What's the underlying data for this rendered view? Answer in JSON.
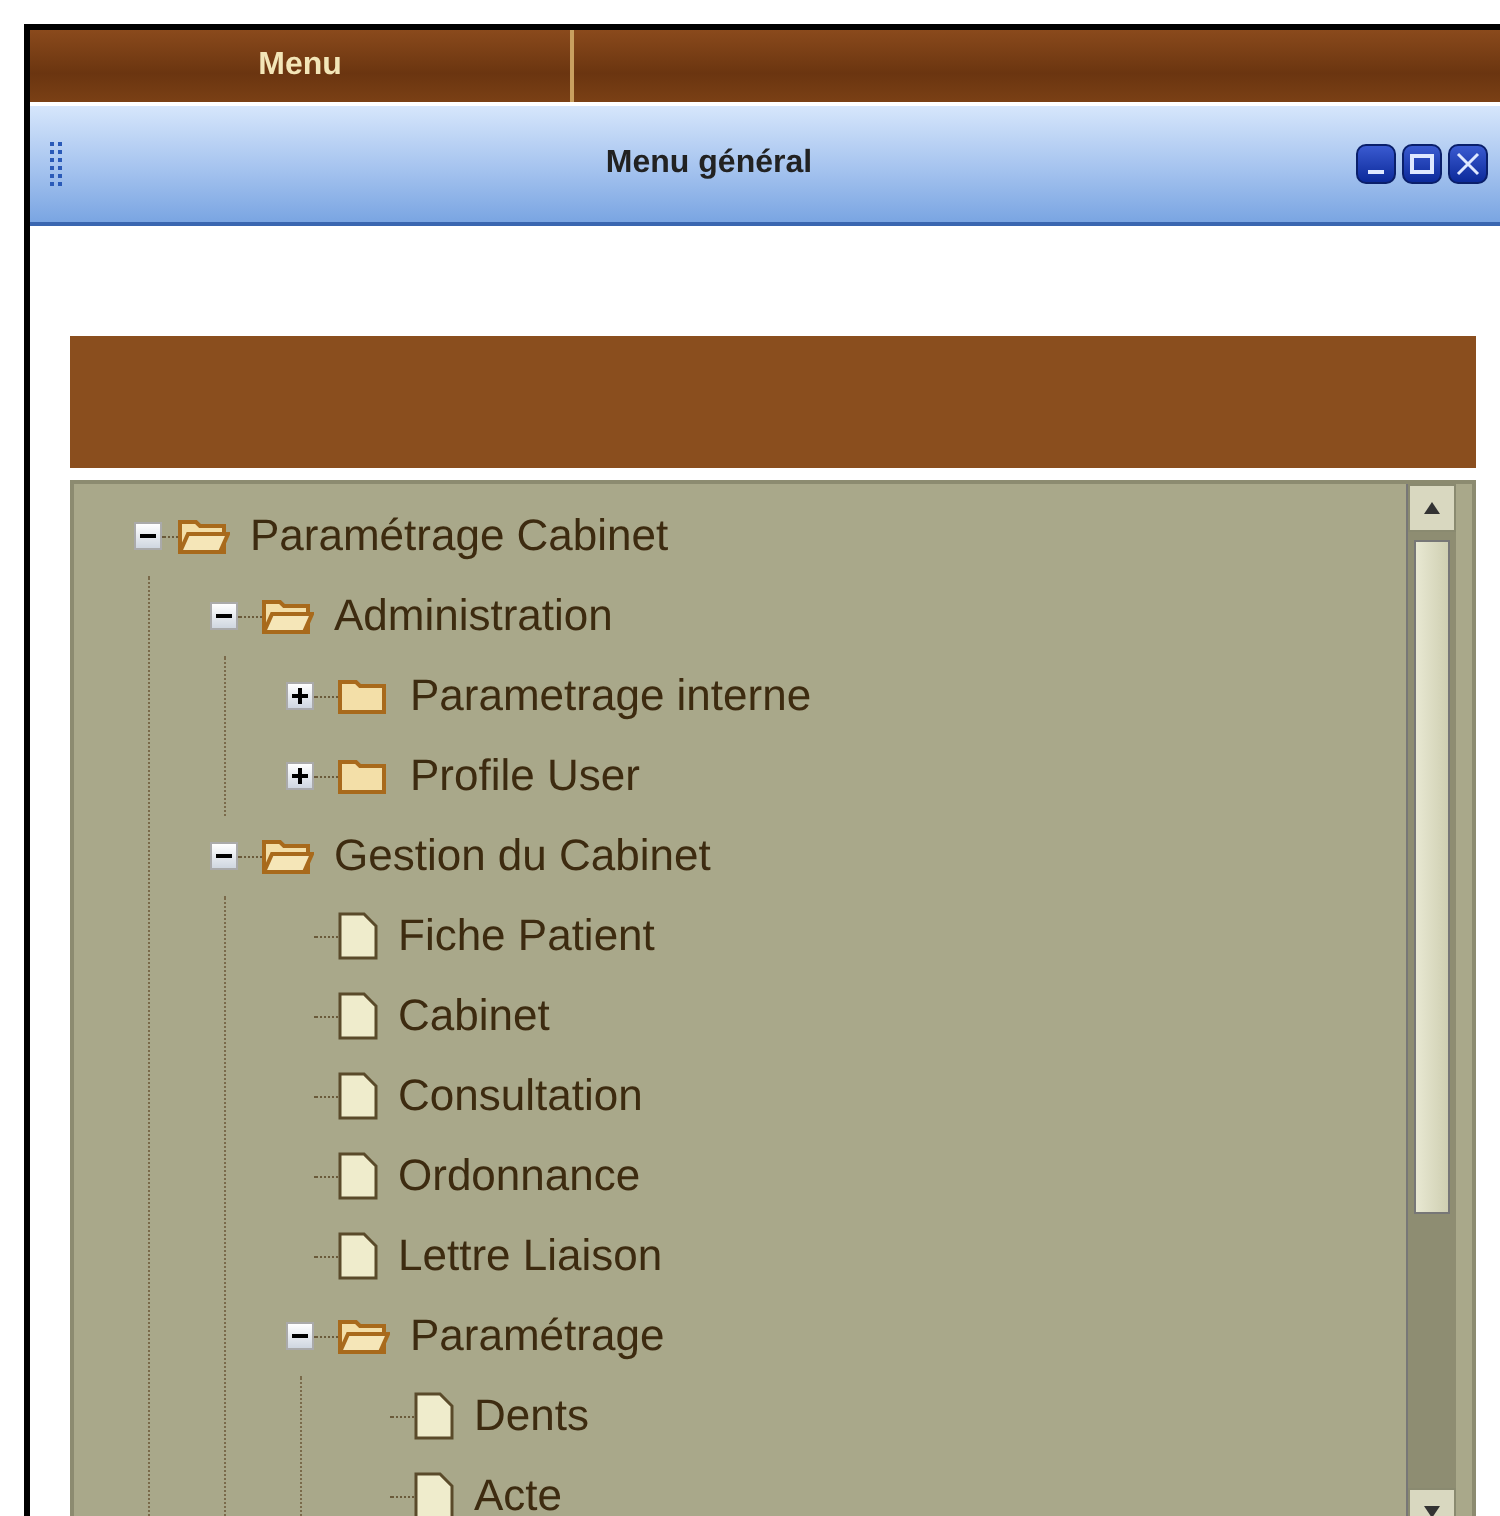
{
  "menu_bar": {
    "tab": "Menu"
  },
  "window": {
    "title": "Menu général"
  },
  "tree": [
    {
      "label": "Paramétrage Cabinet",
      "kind": "folder",
      "expanded": true,
      "children": [
        {
          "label": "Administration",
          "kind": "folder",
          "expanded": true,
          "children": [
            {
              "label": "Parametrage interne",
              "kind": "folder",
              "expanded": false
            },
            {
              "label": "Profile User",
              "kind": "folder",
              "expanded": false
            }
          ]
        },
        {
          "label": "Gestion du Cabinet",
          "kind": "folder",
          "expanded": true,
          "children": [
            {
              "label": "Fiche Patient",
              "kind": "file"
            },
            {
              "label": "Cabinet",
              "kind": "file"
            },
            {
              "label": "Consultation",
              "kind": "file"
            },
            {
              "label": "Ordonnance",
              "kind": "file"
            },
            {
              "label": "Lettre Liaison",
              "kind": "file"
            },
            {
              "label": "Paramétrage",
              "kind": "folder",
              "expanded": true,
              "children": [
                {
                  "label": "Dents",
                  "kind": "file"
                },
                {
                  "label": "Acte",
                  "kind": "file"
                }
              ]
            }
          ]
        }
      ]
    }
  ]
}
